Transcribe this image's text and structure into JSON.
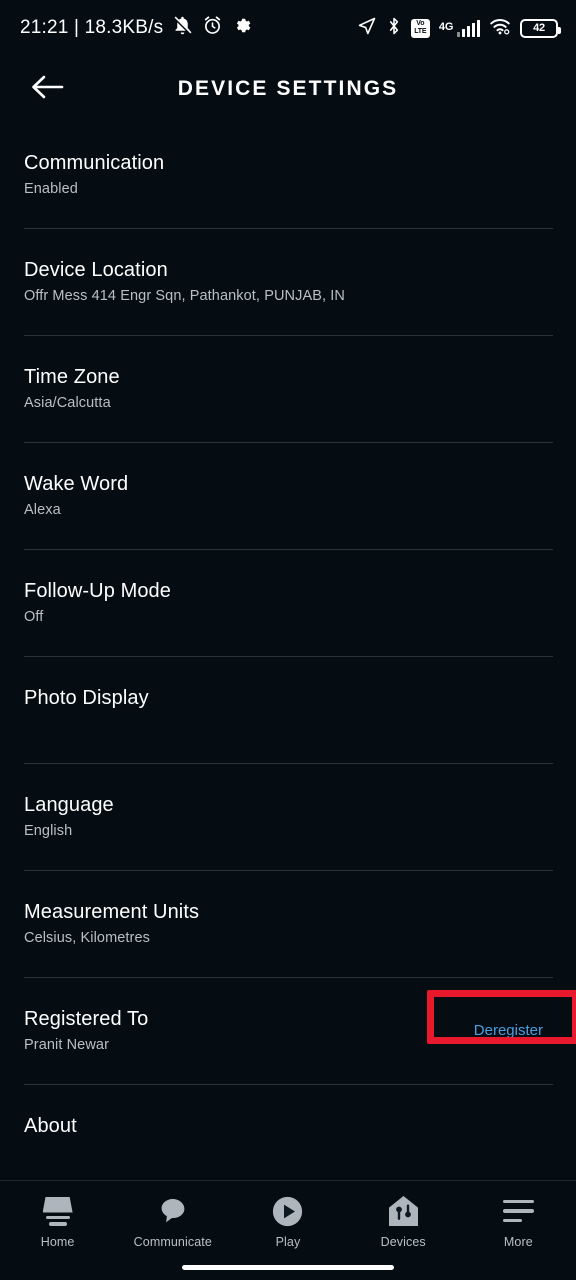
{
  "status_bar": {
    "clock_text": "21:21 | 18.3KB/s",
    "left_icons": [
      "bell-muted-icon",
      "alarm-clock-icon",
      "gear-icon"
    ],
    "right_icons": [
      "location-arrow-icon",
      "bluetooth-icon",
      "volte-icon",
      "signal-4g-icon",
      "wifi-icon",
      "battery-icon"
    ],
    "volte_top": "Vo",
    "volte_bottom": "LTE",
    "network_type": "4G",
    "battery_level": "42"
  },
  "header": {
    "title": "DEVICE SETTINGS",
    "back_icon": "arrow-left-icon"
  },
  "settings": {
    "rows": [
      {
        "title": "Communication",
        "subtitle": "Enabled",
        "action": ""
      },
      {
        "title": "Device Location",
        "subtitle": "Offr Mess 414 Engr Sqn, Pathankot, PUNJAB, IN",
        "action": ""
      },
      {
        "title": "Time Zone",
        "subtitle": "Asia/Calcutta",
        "action": ""
      },
      {
        "title": "Wake Word",
        "subtitle": "Alexa",
        "action": ""
      },
      {
        "title": "Follow-Up Mode",
        "subtitle": "Off",
        "action": ""
      },
      {
        "title": "Photo Display",
        "subtitle": "",
        "action": ""
      },
      {
        "title": "Language",
        "subtitle": "English",
        "action": ""
      },
      {
        "title": "Measurement Units",
        "subtitle": "Celsius, Kilometres",
        "action": ""
      },
      {
        "title": "Registered To",
        "subtitle": "Pranit Newar",
        "action": "Deregister"
      },
      {
        "title": "About",
        "subtitle": "",
        "action": ""
      }
    ]
  },
  "bottom_nav": {
    "items": [
      {
        "label": "Home",
        "icon": "echo-device-icon"
      },
      {
        "label": "Communicate",
        "icon": "speech-bubble-icon"
      },
      {
        "label": "Play",
        "icon": "play-circle-icon"
      },
      {
        "label": "Devices",
        "icon": "home-devices-icon"
      },
      {
        "label": "More",
        "icon": "hamburger-menu-icon"
      }
    ]
  },
  "colors": {
    "background": "#050d13",
    "text_primary": "#ffffff",
    "text_secondary": "#b9bfc5",
    "link": "#4a9fe0",
    "highlight": "#e8192c",
    "divider": "#2a3138",
    "icon_gray": "#aeb5bc"
  }
}
